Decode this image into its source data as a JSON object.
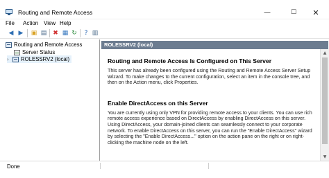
{
  "window": {
    "title": "Routing and Remote Access",
    "minimize_glyph": "—",
    "maximize_glyph": "☐",
    "close_glyph": "✕"
  },
  "menu": {
    "items": [
      "File",
      "Action",
      "View",
      "Help"
    ]
  },
  "toolbar": {
    "buttons": [
      {
        "icon": "back-arrow-icon",
        "glyph": "◀",
        "color": "#2f6fb3"
      },
      {
        "icon": "forward-arrow-icon",
        "glyph": "▶",
        "color": "#2f6fb3"
      },
      {
        "icon": "up-folder-icon",
        "glyph": "▣",
        "color": "#d9a327"
      },
      {
        "icon": "show-hide-tree-icon",
        "glyph": "▤",
        "color": "#4a6a8a"
      },
      {
        "icon": "delete-icon",
        "glyph": "✖",
        "color": "#d03030"
      },
      {
        "icon": "properties-icon",
        "glyph": "▦",
        "color": "#3a7ac0"
      },
      {
        "icon": "refresh-icon",
        "glyph": "↻",
        "color": "#2a8a3a"
      },
      {
        "icon": "export-list-icon",
        "glyph": "⇲",
        "color": "#5a5a5a"
      },
      {
        "icon": "help-icon",
        "glyph": "?",
        "color": "#1f5fb0"
      },
      {
        "icon": "console-icon",
        "glyph": "▥",
        "color": "#4a6a8a"
      }
    ]
  },
  "tree": {
    "root": "Routing and Remote Access",
    "items": [
      {
        "label": "Server Status"
      },
      {
        "label": "ROLESSRV2 (local)",
        "arrow": "›"
      }
    ]
  },
  "detail": {
    "header": "ROLESSRV2 (local)",
    "sections": [
      {
        "title": "Routing and Remote Access Is Configured on This Server",
        "text": "This server has already been configured using the Routing and Remote Access Server Setup Wizard. To make changes to the current configuration, select an item in the console tree, and then on the Action menu, click Properties."
      },
      {
        "title": "Enable DirectAccess on this Server",
        "text": "You are currently using only VPN for providing remote access to your clients. You can use rich remote access experience based on DirectAccess by enabling DirectAccess on this server. Using DirectAccess, your domain-joined clients can seamlessly connect to your corporate network. To enable DirectAccess on this server, you can run the \"Enable DirectAccess\" wizard by selecting the \"Enable DirectAccess...\" option on the action pane on the right or on right-clicking the machine node on the left."
      }
    ]
  },
  "scrollbar": {
    "up_glyph": "▲",
    "down_glyph": "▼"
  },
  "status": {
    "text": "Done"
  },
  "colors": {
    "header_bar": "#6c7c90",
    "selection": "#e5f1fb"
  }
}
